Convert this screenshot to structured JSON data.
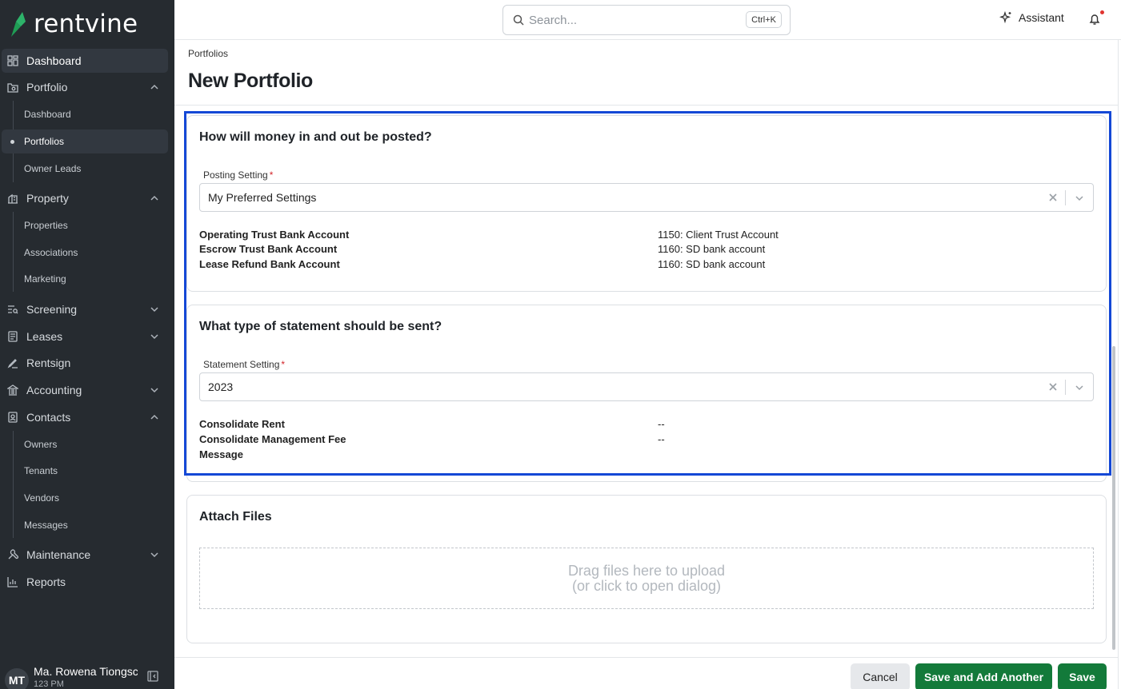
{
  "app": {
    "logo_text": "rentvine",
    "brand_color": "#1f9d55"
  },
  "sidebar": {
    "items": [
      {
        "label": "Dashboard",
        "icon": "dashboard-icon"
      },
      {
        "label": "Portfolio",
        "icon": "portfolio-icon",
        "expanded": true,
        "children": [
          "Dashboard",
          "Portfolios",
          "Owner Leads"
        ],
        "active_child": "Portfolios"
      },
      {
        "label": "Property",
        "icon": "building-icon",
        "expanded": true,
        "children": [
          "Properties",
          "Associations",
          "Marketing"
        ]
      },
      {
        "label": "Screening",
        "icon": "screening-icon",
        "expanded": false
      },
      {
        "label": "Leases",
        "icon": "lease-icon",
        "expanded": false
      },
      {
        "label": "Rentsign",
        "icon": "signature-icon"
      },
      {
        "label": "Accounting",
        "icon": "bank-icon",
        "expanded": false
      },
      {
        "label": "Contacts",
        "icon": "contacts-icon",
        "expanded": true,
        "children": [
          "Owners",
          "Tenants",
          "Vendors",
          "Messages"
        ]
      },
      {
        "label": "Maintenance",
        "icon": "wrench-icon",
        "expanded": false
      },
      {
        "label": "Reports",
        "icon": "reports-icon"
      }
    ],
    "user": {
      "initials": "MT",
      "name": "Ma. Rowena Tiongsc",
      "sub": "123 PM"
    }
  },
  "topbar": {
    "search_placeholder": "Search...",
    "search_shortcut": "Ctrl+K",
    "assistant_label": "Assistant"
  },
  "header": {
    "breadcrumb": "Portfolios",
    "title": "New Portfolio"
  },
  "posting": {
    "title": "How will money in and out be posted?",
    "field_label": "Posting Setting",
    "required_mark": "*",
    "value": "My Preferred Settings",
    "rows": [
      {
        "label": "Operating Trust Bank Account",
        "value": "1150: Client Trust Account"
      },
      {
        "label": "Escrow Trust Bank Account",
        "value": "1160: SD bank account"
      },
      {
        "label": "Lease Refund Bank Account",
        "value": "1160: SD bank account"
      }
    ]
  },
  "statement": {
    "title": "What type of statement should be sent?",
    "field_label": "Statement Setting",
    "required_mark": "*",
    "value": "2023",
    "rows": [
      {
        "label": "Consolidate Rent",
        "value": "--"
      },
      {
        "label": "Consolidate Management Fee",
        "value": "--"
      },
      {
        "label": "Message",
        "value": ""
      }
    ]
  },
  "attach": {
    "title": "Attach Files",
    "drop_line1": "Drag files here to upload",
    "drop_line2": "(or click to open dialog)"
  },
  "footer": {
    "cancel_label": "Cancel",
    "save_another_label": "Save and Add Another",
    "save_label": "Save"
  }
}
